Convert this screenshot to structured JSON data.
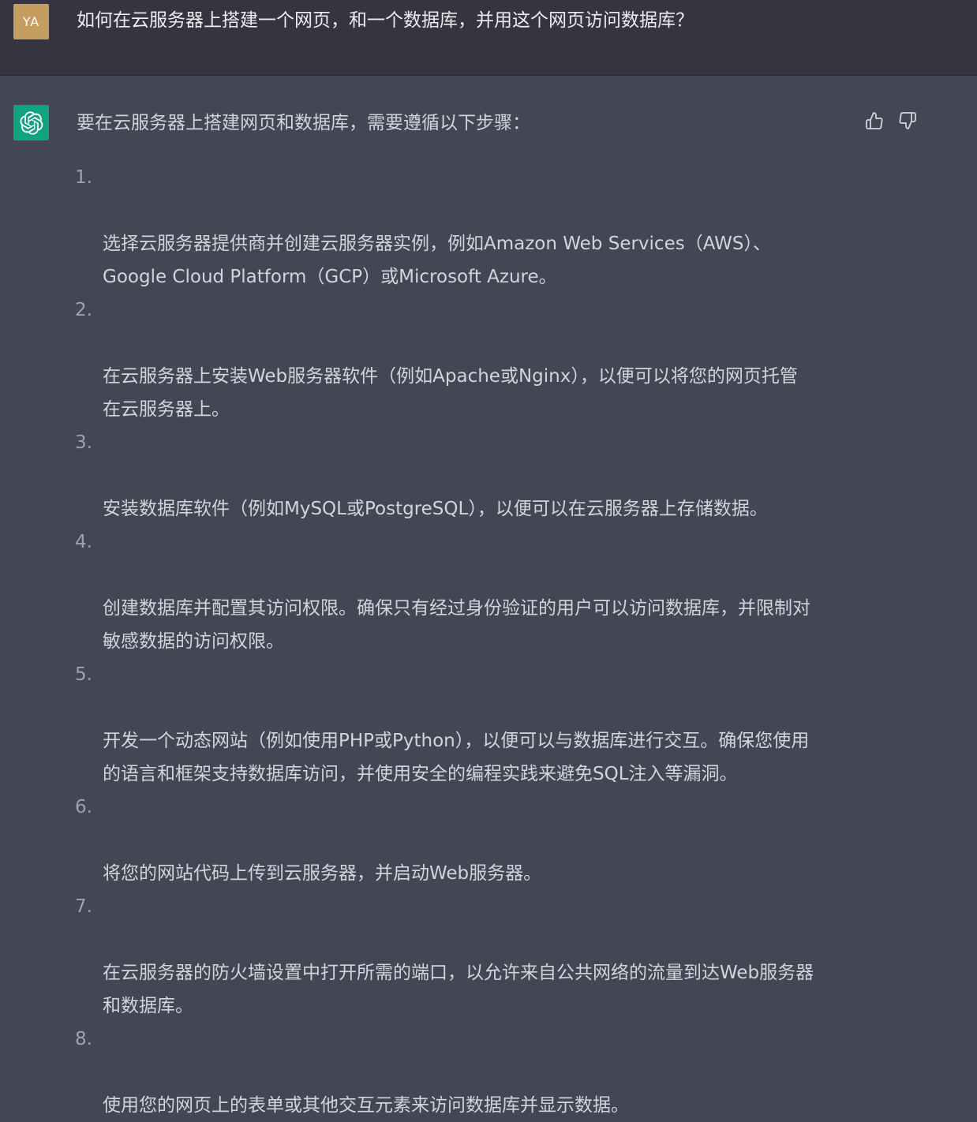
{
  "user": {
    "avatar_text": "YA",
    "message": "如何在云服务器上搭建一个网页，和一个数据库，并用这个网页访问数据库？"
  },
  "assistant": {
    "logo_icon": "openai-logo-icon",
    "intro": "要在云服务器上搭建网页和数据库，需要遵循以下步骤：",
    "steps": [
      {
        "num": "1.",
        "text": "选择云服务器提供商并创建云服务器实例，例如Amazon Web Services（AWS）、\nGoogle Cloud Platform（GCP）或Microsoft Azure。"
      },
      {
        "num": "2.",
        "text": "在云服务器上安装Web服务器软件（例如Apache或Nginx），以便可以将您的网页托管\n在云服务器上。"
      },
      {
        "num": "3.",
        "text": "安装数据库软件（例如MySQL或PostgreSQL），以便可以在云服务器上存储数据。"
      },
      {
        "num": "4.",
        "text": "创建数据库并配置其访问权限。确保只有经过身份验证的用户可以访问数据库，并限制对\n敏感数据的访问权限。"
      },
      {
        "num": "5.",
        "text": "开发一个动态网站（例如使用PHP或Python），以便可以与数据库进行交互。确保您使用\n的语言和框架支持数据库访问，并使用安全的编程实践来避免SQL注入等漏洞。"
      },
      {
        "num": "6.",
        "text": "将您的网站代码上传到云服务器，并启动Web服务器。"
      },
      {
        "num": "7.",
        "text": "在云服务器的防火墙设置中打开所需的端口，以允许来自公共网络的流量到达Web服务器\n和数据库。"
      },
      {
        "num": "8.",
        "text": "使用您的网页上的表单或其他交互元素来访问数据库并显示数据。"
      }
    ]
  },
  "colors": {
    "user_bg": "#343541",
    "assistant_bg": "#444654",
    "user_avatar": "#c59d5f",
    "assistant_avatar": "#10a37f"
  }
}
